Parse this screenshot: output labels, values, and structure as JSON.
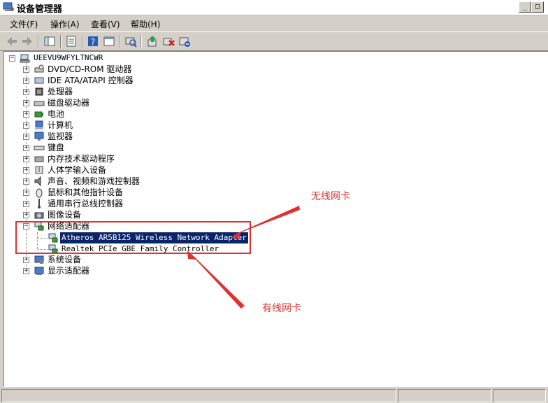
{
  "window": {
    "title": "设备管理器",
    "min_glyph": "_",
    "max_glyph": "□",
    "close_glyph": "×"
  },
  "menu": {
    "items": [
      "文件(F)",
      "操作(A)",
      "查看(V)",
      "帮助(H)"
    ]
  },
  "toolbar": {
    "buttons": [
      "back-icon",
      "forward-icon",
      "properties-icon",
      "view-icon",
      "help-icon",
      "console-icon",
      "scan-icon",
      "update-driver-icon",
      "uninstall-icon",
      "disable-icon"
    ]
  },
  "tree": {
    "root": "UEEVU9WFYLTNCWR",
    "categories": [
      "DVD/CD-ROM 驱动器",
      "IDE ATA/ATAPI 控制器",
      "处理器",
      "磁盘驱动器",
      "电池",
      "计算机",
      "监视器",
      "键盘",
      "内存技术驱动程序",
      "人体学输入设备",
      "声音、视频和游戏控制器",
      "鼠标和其他指针设备",
      "通用串行总线控制器",
      "图像设备",
      "网络适配器",
      "系统设备",
      "显示适配器"
    ],
    "network_children": [
      "Atheros AR5B125 Wireless Network Adapter",
      "Realtek PCIe GBE Family Controller"
    ]
  },
  "annotations": {
    "wireless": "无线网卡",
    "wired": "有线网卡",
    "color": "#e03030"
  }
}
